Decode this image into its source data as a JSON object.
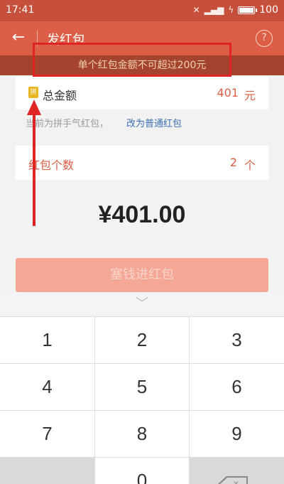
{
  "status_bar": {
    "time": "17:41",
    "battery": "100",
    "battery_level": 1.0
  },
  "app_bar": {
    "title": "发红包",
    "back_icon": "back-arrow-icon",
    "help_icon": "help-icon",
    "help_glyph": "?"
  },
  "warning": {
    "text": "单个红包金额不可超过200元"
  },
  "amount": {
    "label": "总金额",
    "value": "401",
    "unit": "元",
    "pin_glyph": "拼"
  },
  "mode": {
    "hint": "当前为拼手气红包，",
    "link": "改为普通红包"
  },
  "count": {
    "label": "红包个数",
    "value": "2",
    "unit": "个"
  },
  "total": "¥401.00",
  "send_button": {
    "label": "塞钱进红包"
  },
  "keyboard": {
    "handle_icon": "chevron-down-icon",
    "keys": [
      "1",
      "2",
      "3",
      "4",
      "5",
      "6",
      "7",
      "8",
      "9",
      "",
      "0",
      ""
    ],
    "delete_glyph": "×"
  },
  "colors": {
    "header": "#dd5e46",
    "status": "#c7503c",
    "warning_bg": "#a4432e",
    "warning_text": "#f3d2b0",
    "accent": "#dd5e46",
    "link": "#3b6fb5",
    "button_disabled": "#f5a796",
    "annotation": "#e02424"
  }
}
